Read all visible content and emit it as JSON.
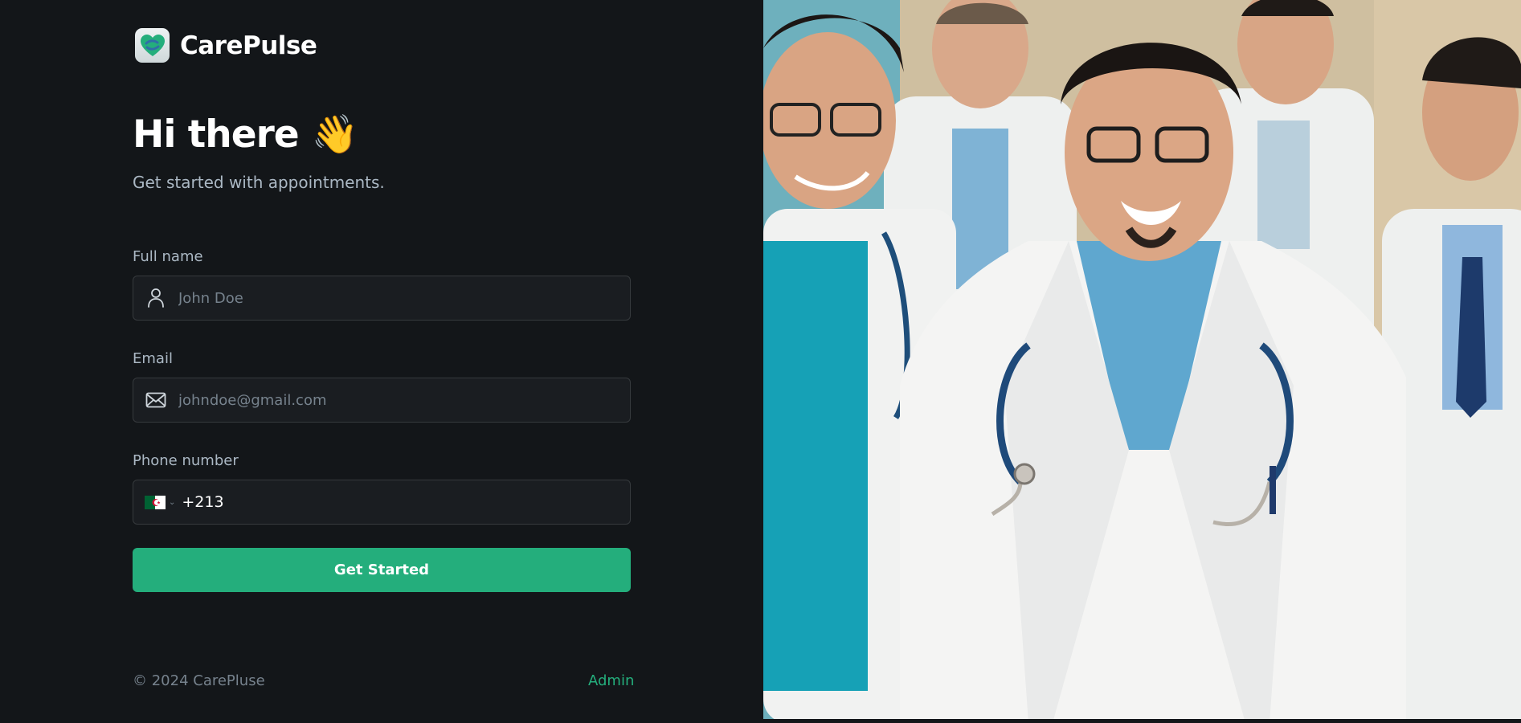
{
  "brand": {
    "name": "CarePulse"
  },
  "hero": {
    "title": "Hi there",
    "emoji": "👋",
    "subtitle": "Get started with appointments."
  },
  "form": {
    "full_name": {
      "label": "Full name",
      "placeholder": "John Doe"
    },
    "email": {
      "label": "Email",
      "placeholder": "johndoe@gmail.com"
    },
    "phone": {
      "label": "Phone number",
      "value": "+213",
      "flag_icon": "algeria-flag-icon"
    },
    "submit_label": "Get Started"
  },
  "footer": {
    "copyright": "© 2024 CarePluse",
    "admin_link": "Admin"
  },
  "colors": {
    "background": "#131619",
    "accent": "#24ae7c",
    "input_bg": "#1a1d21",
    "muted": "#abb8c4"
  },
  "image": {
    "alt": "Group of smiling doctors in white coats with stethoscopes"
  }
}
